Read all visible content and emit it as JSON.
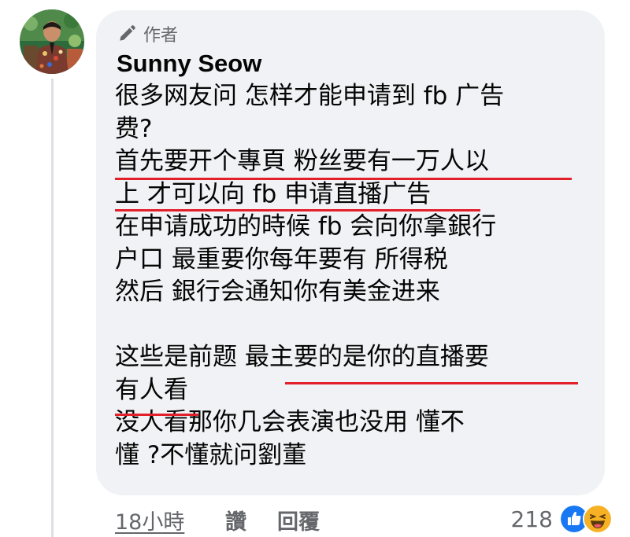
{
  "comment": {
    "badge_label": "作者",
    "author_name": "Sunny Seow",
    "lines": [
      "很多网友问  怎样才能申请到 fb 广告",
      "费?",
      "首先要开个專頁  粉丝要有一万人以",
      "上  才可以向 fb 申请直播广告",
      "在申请成功的時候 fb 会向你拿銀行",
      "户口  最重要你每年要有  所得税",
      "然后  銀行会通知你有美金进来",
      "",
      "这些是前题   最主要的是你的直播要",
      "有人看",
      "没人看那你几会表演也没用  懂不",
      "懂 ?不懂就问劉董"
    ],
    "highlighted_lines": [
      2,
      3,
      8,
      9
    ]
  },
  "footer": {
    "timestamp": "18小時",
    "like_label": "讚",
    "reply_label": "回覆",
    "reaction_count": "218"
  },
  "reactions": [
    "like-reaction",
    "haha-reaction"
  ],
  "colors": {
    "bubble": "#f0f2f5",
    "secondary_text": "#65676b",
    "underline": "#e3202a",
    "like_blue": "#1877f2",
    "haha_yellow": "#f7b125"
  }
}
